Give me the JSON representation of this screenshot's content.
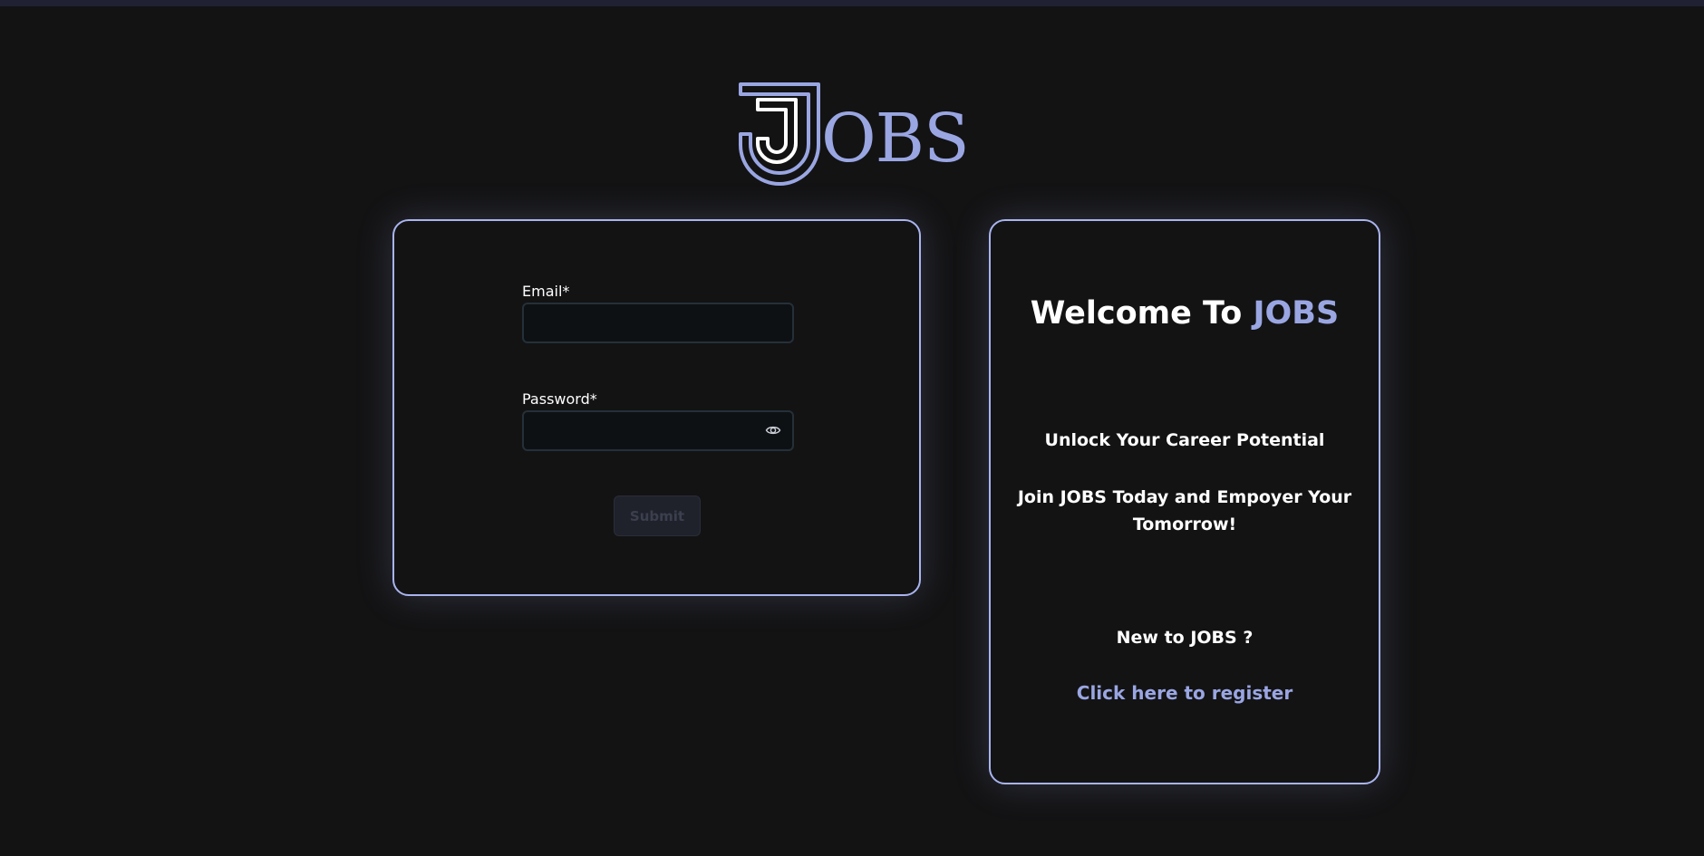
{
  "logo": {
    "text": "OBS",
    "mark_letter": "J"
  },
  "login_form": {
    "email_label": "Email*",
    "email_value": "",
    "password_label": "Password*",
    "password_value": "",
    "show_password_icon": "eye-icon",
    "submit_label": "Submit"
  },
  "welcome": {
    "title_prefix": "Welcome To ",
    "title_brand": "JOBS",
    "tagline": "Unlock Your Career Potential",
    "join_text": "Join JOBS Today and Empoyer Your Tomorrow!",
    "new_text": "New to JOBS ?",
    "register_link": "Click here to register"
  },
  "colors": {
    "background": "#131314",
    "accent": "#9aa6e2",
    "card_border": "#a9b4ee",
    "input_background": "#0e1114",
    "button_background": "#20222b"
  }
}
